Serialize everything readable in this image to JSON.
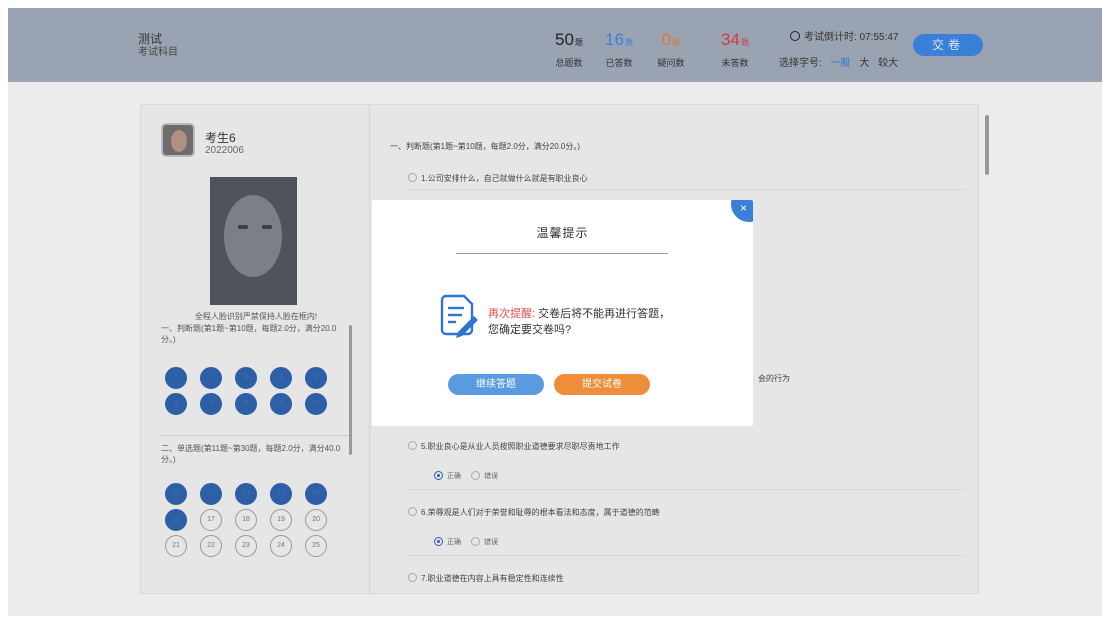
{
  "header": {
    "exam_title": "测试",
    "exam_subject": "考试科目",
    "stats": [
      {
        "num": "50",
        "unit": "题",
        "label": "总题数",
        "color": "#222222"
      },
      {
        "num": "16",
        "unit": "题",
        "label": "已答数",
        "color": "#3a7fd8"
      },
      {
        "num": "0",
        "unit": "题",
        "label": "疑问数",
        "color": "#e07a2c"
      },
      {
        "num": "34",
        "unit": "题",
        "label": "未答数",
        "color": "#d23c3c"
      }
    ],
    "countdown_label": "考试倒计时: 07:55:47",
    "fontsize_label": "选择字号:",
    "fontsize_options": [
      "一般",
      "大",
      "较大"
    ],
    "submit_label": "交卷"
  },
  "candidate": {
    "name": "考生6",
    "exam_no": "2022006",
    "face_notice": "全程人脸识别严禁保持人脸在框内!"
  },
  "sections": [
    {
      "title": "一、判断题(第1题~第10题，每题2.0分，满分20.0分。)",
      "numbers": [
        "1",
        "2",
        "3",
        "4",
        "5",
        "6",
        "7",
        "8",
        "9",
        "10"
      ],
      "answered": [
        true,
        true,
        true,
        true,
        true,
        true,
        true,
        true,
        true,
        true
      ]
    },
    {
      "title": "二、单选题(第11题~第30题，每题2.0分，满分40.0分。)",
      "numbers": [
        "11",
        "12",
        "13",
        "14",
        "15",
        "16",
        "17",
        "18",
        "19",
        "20",
        "21",
        "22",
        "23",
        "24",
        "25"
      ],
      "answered": [
        true,
        true,
        true,
        true,
        true,
        true,
        false,
        false,
        false,
        false,
        false,
        false,
        false,
        false,
        false
      ]
    }
  ],
  "questions": {
    "section_header": "一、判断题(第1题~第10题，每题2.0分，满分20.0分。)",
    "items": [
      {
        "text": "1.公司安排什么，自己就做什么就是有职业良心"
      },
      {
        "text": "5.职业良心是从业人员按照职业道德要求尽职尽责地工作"
      },
      {
        "text": "6.荣辱观是人们对于荣誉和耻辱的根本看法和态度，属于道德的范畴"
      },
      {
        "text": "7.职业道德在内容上具有稳定性和连续性"
      }
    ],
    "fragment": "会的行为",
    "option_correct": "正确",
    "option_wrong": "错误"
  },
  "modal": {
    "title": "温馨提示",
    "highlight": "再次提醒:",
    "message": "交卷后将不能再进行答题，您确定要交卷吗?",
    "close_label": "×",
    "continue_label": "继续答题",
    "submit_label": "提交试卷",
    "icon": "edit-document-icon"
  }
}
